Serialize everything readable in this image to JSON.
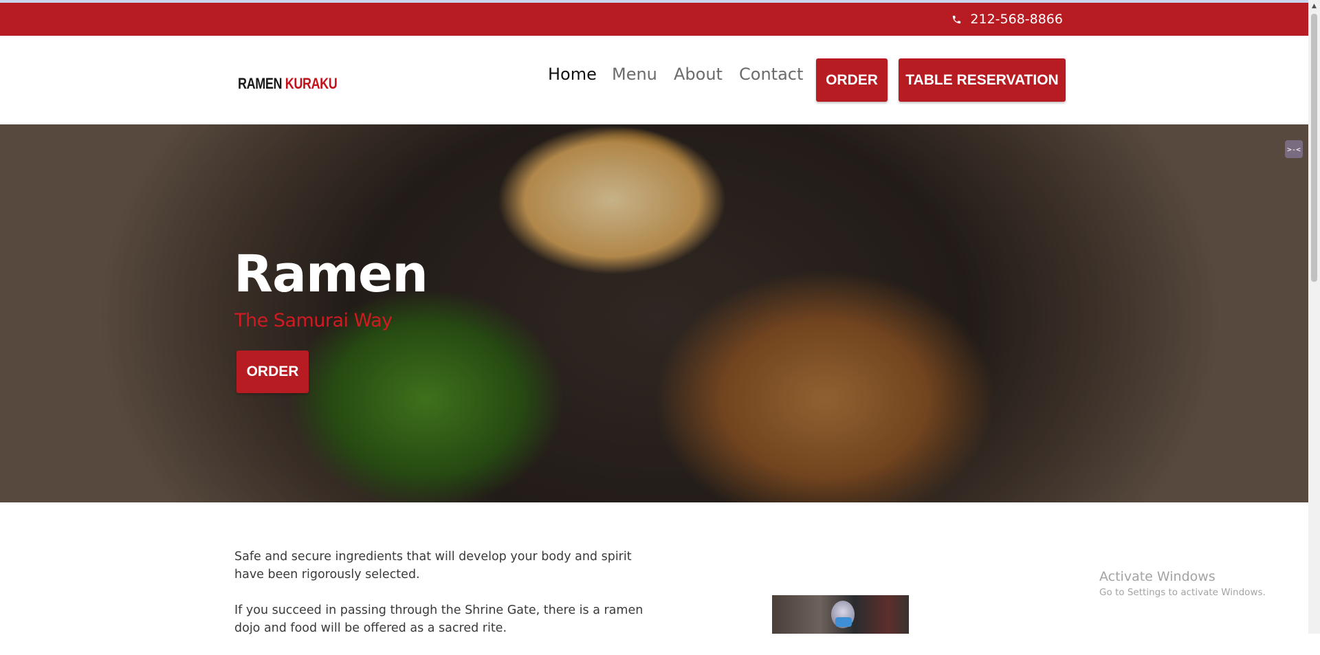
{
  "topbar": {
    "phone": "212-568-8866"
  },
  "header": {
    "logo_part1": "RAMEN",
    "logo_part2": "KURAKU",
    "nav": [
      {
        "label": "Home",
        "active": true
      },
      {
        "label": "Menu",
        "active": false
      },
      {
        "label": "About",
        "active": false
      },
      {
        "label": "Contact",
        "active": false
      }
    ],
    "order_label": "ORDER",
    "reservation_label": "TABLE RESERVATION"
  },
  "hero": {
    "title": "Ramen",
    "subtitle": "The Samurai Way",
    "order_label": "ORDER",
    "image_alt": "ramen-bowl-hero-image"
  },
  "intro": {
    "paragraph1": "Safe and secure ingredients that will develop your body and spirit have been rigorously selected.",
    "paragraph2": "If you succeed in passing through the Shrine Gate, there is a ramen dojo and food will be offered as a sacred rite."
  },
  "os_overlay": {
    "activate_title": "Activate Windows",
    "activate_sub": "Go to Settings to activate Windows."
  },
  "colors": {
    "brand_red": "#b81c23",
    "subtitle_red": "#d11a22"
  },
  "icons": {
    "phone": "phone-icon",
    "extension": "extension-icon"
  }
}
